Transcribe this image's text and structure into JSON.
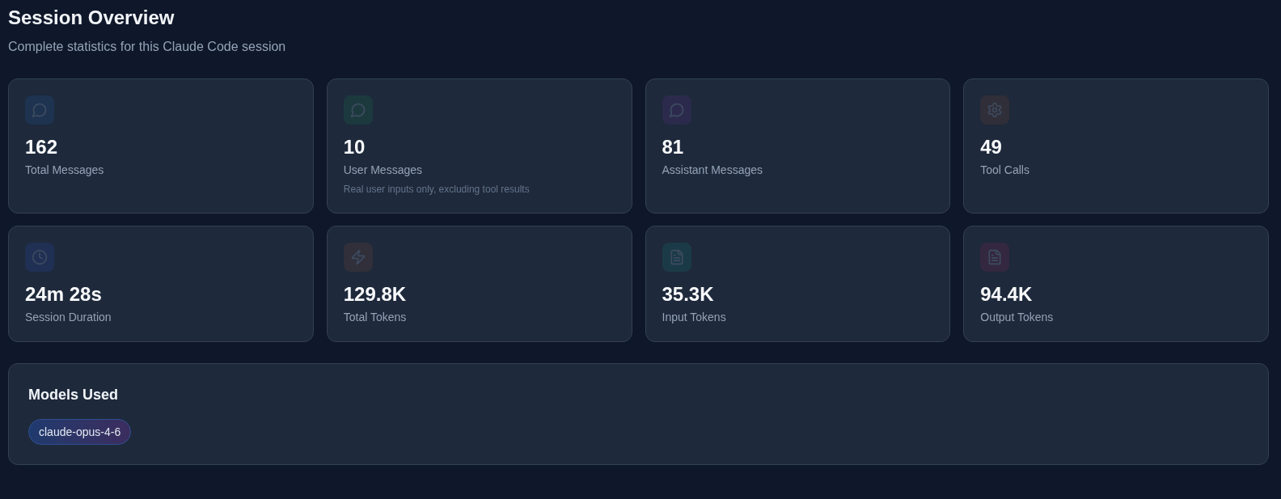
{
  "header": {
    "title": "Session Overview",
    "subtitle": "Complete statistics for this Claude Code session"
  },
  "stats": [
    {
      "kind": "chat",
      "color": "#1d3350",
      "value": "162",
      "label": "Total Messages"
    },
    {
      "kind": "chat",
      "color": "#1c3a3e",
      "value": "10",
      "label": "User Messages",
      "note": "Real user inputs only, excluding tool results"
    },
    {
      "kind": "chat",
      "color": "#2b2a4c",
      "value": "81",
      "label": "Assistant Messages"
    },
    {
      "kind": "gear",
      "color": "#302e38",
      "value": "49",
      "label": "Tool Calls"
    },
    {
      "kind": "clock",
      "color": "#1f3054",
      "value": "24m 28s",
      "label": "Session Duration"
    },
    {
      "kind": "bolt",
      "color": "#302f3a",
      "value": "129.8K",
      "label": "Total Tokens"
    },
    {
      "kind": "document",
      "color": "#1b3a47",
      "value": "35.3K",
      "label": "Input Tokens"
    },
    {
      "kind": "document",
      "color": "#33283f",
      "value": "94.4K",
      "label": "Output Tokens"
    }
  ],
  "models": {
    "title": "Models Used",
    "items": [
      "claude-opus-4-6"
    ]
  }
}
